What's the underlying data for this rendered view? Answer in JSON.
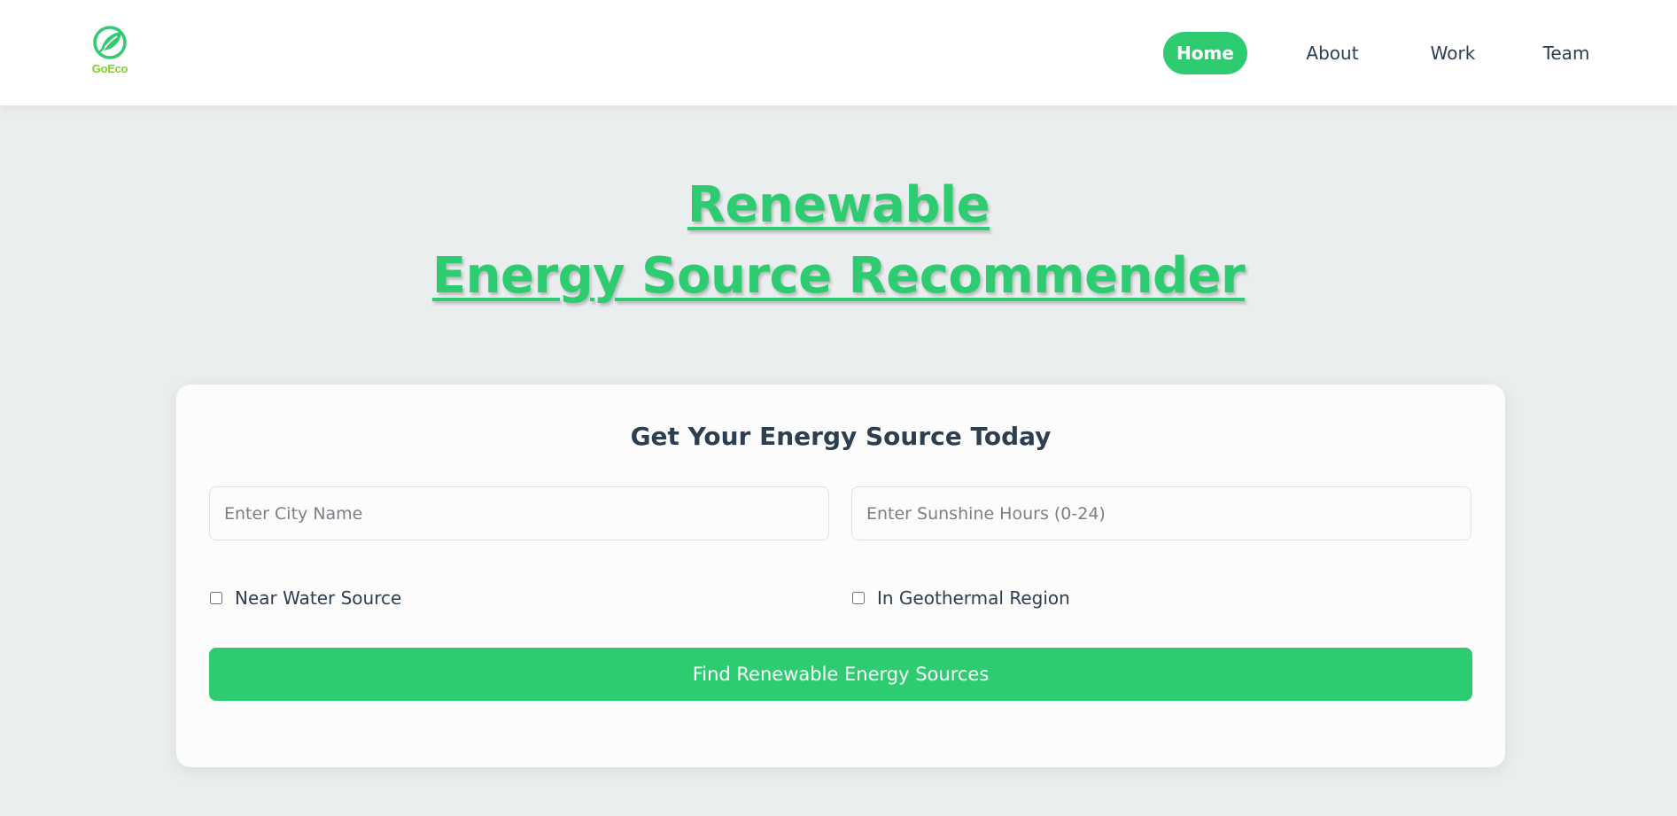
{
  "brand": {
    "logo_text": "GoEco",
    "logo_color": "#7ed321",
    "logo_icon": "leaf-icon"
  },
  "nav": {
    "items": [
      {
        "label": "Home",
        "active": true
      },
      {
        "label": "About",
        "active": false
      },
      {
        "label": "Work",
        "active": false
      },
      {
        "label": "Team",
        "active": false
      }
    ]
  },
  "hero": {
    "line1": "Renewable",
    "line2": "Energy Source Recommender"
  },
  "form": {
    "title": "Get Your Energy Source Today",
    "city_placeholder": "Enter City Name",
    "city_value": "",
    "sunshine_placeholder": "Enter Sunshine Hours (0-24)",
    "sunshine_value": "",
    "near_water_label": "Near Water Source",
    "near_water_checked": false,
    "geothermal_label": "In Geothermal Region",
    "geothermal_checked": false,
    "submit_label": "Find Renewable Energy Sources"
  },
  "colors": {
    "accent": "#2ecc71",
    "text": "#2c3e50",
    "background": "#ebeeef"
  }
}
